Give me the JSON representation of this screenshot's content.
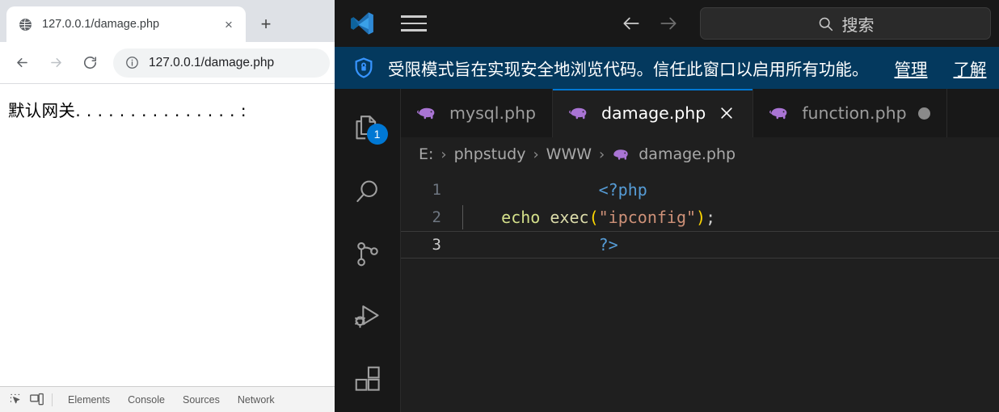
{
  "browser": {
    "tab": {
      "title": "127.0.0.1/damage.php",
      "favicon": "globe-icon",
      "close_label": "×"
    },
    "new_tab_label": "+",
    "nav": {
      "back": "←",
      "forward": "→",
      "reload": "↻"
    },
    "omnibox": {
      "info_icon": "info-circle-icon",
      "url": "127.0.0.1/damage.php"
    },
    "page": {
      "line1": "默认网关. . . . . . . . . . . . . . . :"
    },
    "devtools": {
      "inspect_icon": "inspect-element-icon",
      "device_icon": "device-toolbar-icon",
      "tabs": [
        "Elements",
        "Console",
        "Sources",
        "Network"
      ]
    }
  },
  "vscode": {
    "titlebar": {
      "logo": "vscode-logo-icon",
      "menu_icon": "hamburger-menu-icon",
      "back": "←",
      "forward": "→",
      "search_placeholder": "搜索",
      "search_icon": "search-icon",
      "search_value": ""
    },
    "banner": {
      "icon": "shield-lock-icon",
      "message": "受限模式旨在实现安全地浏览代码。信任此窗口以启用所有功能。",
      "link_manage": "管理",
      "link_learn": "了解"
    },
    "activitybar": [
      {
        "name": "explorer",
        "icon": "files-icon",
        "badge": "1"
      },
      {
        "name": "search",
        "icon": "search-icon",
        "badge": ""
      },
      {
        "name": "source-control",
        "icon": "source-control-icon",
        "badge": ""
      },
      {
        "name": "run-and-debug",
        "icon": "run-debug-icon",
        "badge": ""
      },
      {
        "name": "extensions",
        "icon": "extensions-icon",
        "badge": ""
      }
    ],
    "tabs": [
      {
        "label": "mysql.php",
        "icon": "php-elephant-icon",
        "active": false,
        "dirty": false
      },
      {
        "label": "damage.php",
        "icon": "php-elephant-icon",
        "active": true,
        "dirty": false
      },
      {
        "label": "function.php",
        "icon": "php-elephant-icon",
        "active": false,
        "dirty": true
      }
    ],
    "breadcrumb": {
      "drive": "E:",
      "sep1": "›",
      "folder1": "phpstudy",
      "sep2": "›",
      "folder2": "WWW",
      "sep3": "›",
      "file_icon": "php-elephant-icon",
      "file": "damage.php"
    },
    "code": {
      "lines": [
        {
          "num": "1",
          "content": "<?php"
        },
        {
          "num": "2",
          "content": "    echo exec(\"ipconfig\");"
        },
        {
          "num": "3",
          "content": "?>"
        }
      ],
      "line1_tag": "<?php",
      "line2_indent": "    ",
      "line2_kw": "echo",
      "line2_space": " ",
      "line2_fn": "exec",
      "line2_open": "(",
      "line2_str": "\"ipconfig\"",
      "line2_close": ")",
      "line2_semi": ";",
      "line3_tag": "?>"
    }
  },
  "colors": {
    "vscode_accent": "#0078d4",
    "banner_bg": "#04395e",
    "editor_bg": "#1f1f1f",
    "chrome_tabstrip": "#dee1e6",
    "php_purple": "#a974d4",
    "string_orange": "#ce9178"
  }
}
